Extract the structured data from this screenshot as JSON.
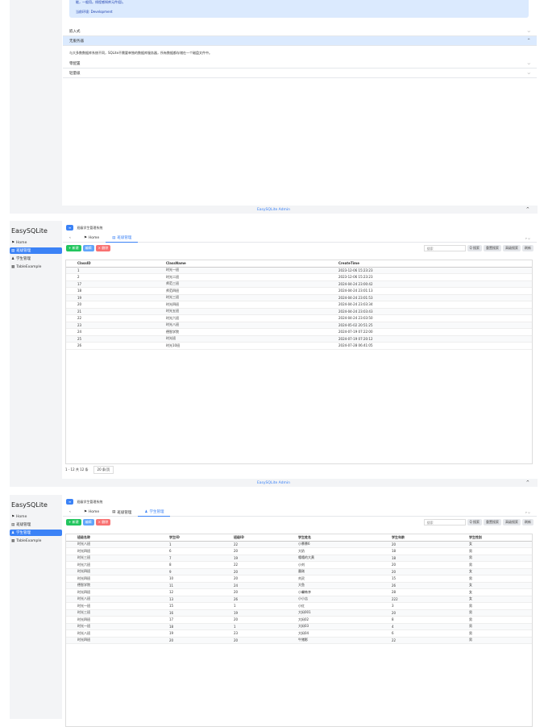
{
  "app": {
    "name": "EasySQLite",
    "footer": "EasySQLite Admin",
    "breadcrumb": "班级学生管理系统"
  },
  "menu": [
    {
      "label": "Home",
      "icon": "flag-icon"
    },
    {
      "label": "班级管理",
      "icon": "class-icon"
    },
    {
      "label": "学生管理",
      "icon": "users-icon"
    },
    {
      "label": "TableExample",
      "icon": "table-icon"
    }
  ],
  "top": {
    "notice_line1": "能，一般用。线程感知库元件组)。",
    "notice_line2": "当前环境: Development",
    "acc": [
      "嵌入式",
      "无服务器",
      "零配置",
      "轻量级"
    ],
    "acc_body": "与大多数数据库系统不同，SQLite不需要单独的数据库服务器，所有数据都存储在一个磁盘文件中。"
  },
  "toolbar": {
    "add": "+ 新建",
    "edit": "编辑",
    "del": "× 删除",
    "search_ph": "搜索",
    "search": "Q 搜索",
    "reset": "重置搜索",
    "adv": "高级搜索",
    "refresh": "刷新"
  },
  "class": {
    "tabs": [
      "Home",
      "班级管理"
    ],
    "headers": [
      "ClassID",
      "ClassName",
      "CreateTime"
    ],
    "rows": [
      [
        "1",
        "时光一班",
        "2023-12-06 15:23:23"
      ],
      [
        "2",
        "时光二班",
        "2023-12-06 15:23:23"
      ],
      [
        "17",
        "师范三班",
        "2024-04-24 23:00:42"
      ],
      [
        "18",
        "师范四班",
        "2024-04-24 23:01:13"
      ],
      [
        "19",
        "时光三班",
        "2024-04-24 23:01:53"
      ],
      [
        "20",
        "时光四班",
        "2024-04-24 23:03:34"
      ],
      [
        "21",
        "时光五班",
        "2024-04-24 23:03:43"
      ],
      [
        "22",
        "时光六班",
        "2024-04-24 23:03:50"
      ],
      [
        "23",
        "时光八班",
        "2024-05-02 20:51:25"
      ],
      [
        "24",
        "德智学院",
        "2024-07-19 07:22:00"
      ],
      [
        "25",
        "时光班",
        "2024-07-19 07:20:12"
      ],
      [
        "26",
        "时光10班",
        "2024-07-28 06:41:05"
      ]
    ],
    "pager": "1 - 12 共 12 条",
    "pagesize": "20 条/页"
  },
  "student": {
    "tabs": [
      "Home",
      "班级管理",
      "学生管理"
    ],
    "headers": [
      "班级名称",
      "学生ID",
      "班级ID",
      "学生姓名",
      "学生年龄",
      "学生性别"
    ],
    "rows": [
      [
        "时光八班",
        "1",
        "22",
        "小慕慕6",
        "20",
        "女"
      ],
      [
        "时光四班",
        "6",
        "20",
        "大奶",
        "18",
        "男"
      ],
      [
        "时光三班",
        "7",
        "19",
        "嘻嘻的大黄",
        "18",
        "男"
      ],
      [
        "时光六班",
        "8",
        "22",
        "小刘",
        "20",
        "男"
      ],
      [
        "时光四班",
        "9",
        "20",
        "墨刚",
        "20",
        "女"
      ],
      [
        "时光四班",
        "10",
        "20",
        "刘灵",
        "15",
        "男"
      ],
      [
        "德智学院",
        "11",
        "24",
        "大鱼",
        "26",
        "女"
      ],
      [
        "时光四班",
        "12",
        "20",
        "小馨韩李",
        "28",
        "女"
      ],
      [
        "时光八班",
        "13",
        "26",
        "小小吉",
        "222",
        "女"
      ],
      [
        "时光一班",
        "15",
        "1",
        "小红",
        "3",
        "男"
      ],
      [
        "时光三班",
        "16",
        "19",
        "大妈001",
        "20",
        "男"
      ],
      [
        "时光四班",
        "17",
        "20",
        "大妈02",
        "8",
        "男"
      ],
      [
        "时光一班",
        "18",
        "1",
        "大妈03",
        "4",
        "男"
      ],
      [
        "时光八班",
        "19",
        "23",
        "大妈04",
        "6",
        "男"
      ],
      [
        "时光四班",
        "20",
        "20",
        "牛猪影",
        "22",
        "男"
      ]
    ]
  }
}
